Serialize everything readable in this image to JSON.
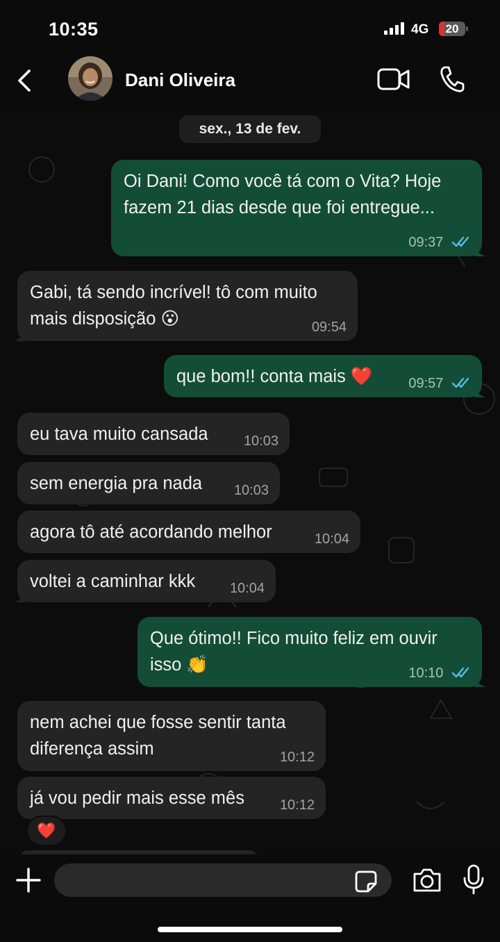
{
  "status_bar": {
    "time": "10:35",
    "network": "4G",
    "battery_level": "20",
    "battery_fraction": 0.2,
    "battery_color": "#e2312d"
  },
  "header": {
    "contact_name": "Dani Oliveira",
    "icons": [
      "chevron-left-icon",
      "avatar",
      "video-camera-icon",
      "phone-icon"
    ]
  },
  "chat": {
    "date_separator": "sex., 13 de fev.",
    "messages": [
      {
        "direction": "out",
        "text": "Oi Dani! Como você tá com o Vita? Hoje\nfazem 21 dias desde que foi entregue...",
        "time": "09:37",
        "read": true
      },
      {
        "direction": "in",
        "text": "Gabi, tá sendo incrível! tô com muito\nmais disposição 😮",
        "time": "09:54"
      },
      {
        "direction": "out",
        "text": "que bom!! conta mais ❤️",
        "time": "09:57",
        "read": true
      },
      {
        "direction": "in",
        "text": "eu tava muito cansada",
        "time": "10:03"
      },
      {
        "direction": "in",
        "text": "sem energia pra nada",
        "time": "10:03"
      },
      {
        "direction": "in",
        "text": "agora tô até acordando melhor",
        "time": "10:04"
      },
      {
        "direction": "in",
        "text": "voltei a caminhar kkk",
        "time": "10:04"
      },
      {
        "direction": "out",
        "text": "Que ótimo!! Fico muito feliz em ouvir\nisso 👏",
        "time": "10:10",
        "read": true
      },
      {
        "direction": "in",
        "text": "nem achei que fosse sentir tanta\ndiferença assim",
        "time": "10:12"
      },
      {
        "direction": "in",
        "text": "já vou pedir mais esse mês",
        "time": "10:12"
      }
    ],
    "reaction": "❤️"
  },
  "input_bar": {
    "placeholder": "",
    "icons": [
      "plus-icon",
      "sticker-icon",
      "camera-icon",
      "microphone-icon"
    ]
  },
  "colors": {
    "outgoing_bubble": "#134d37",
    "incoming_bubble": "#242424",
    "read_check": "#53bdeb",
    "background": "#0b0b0b"
  }
}
